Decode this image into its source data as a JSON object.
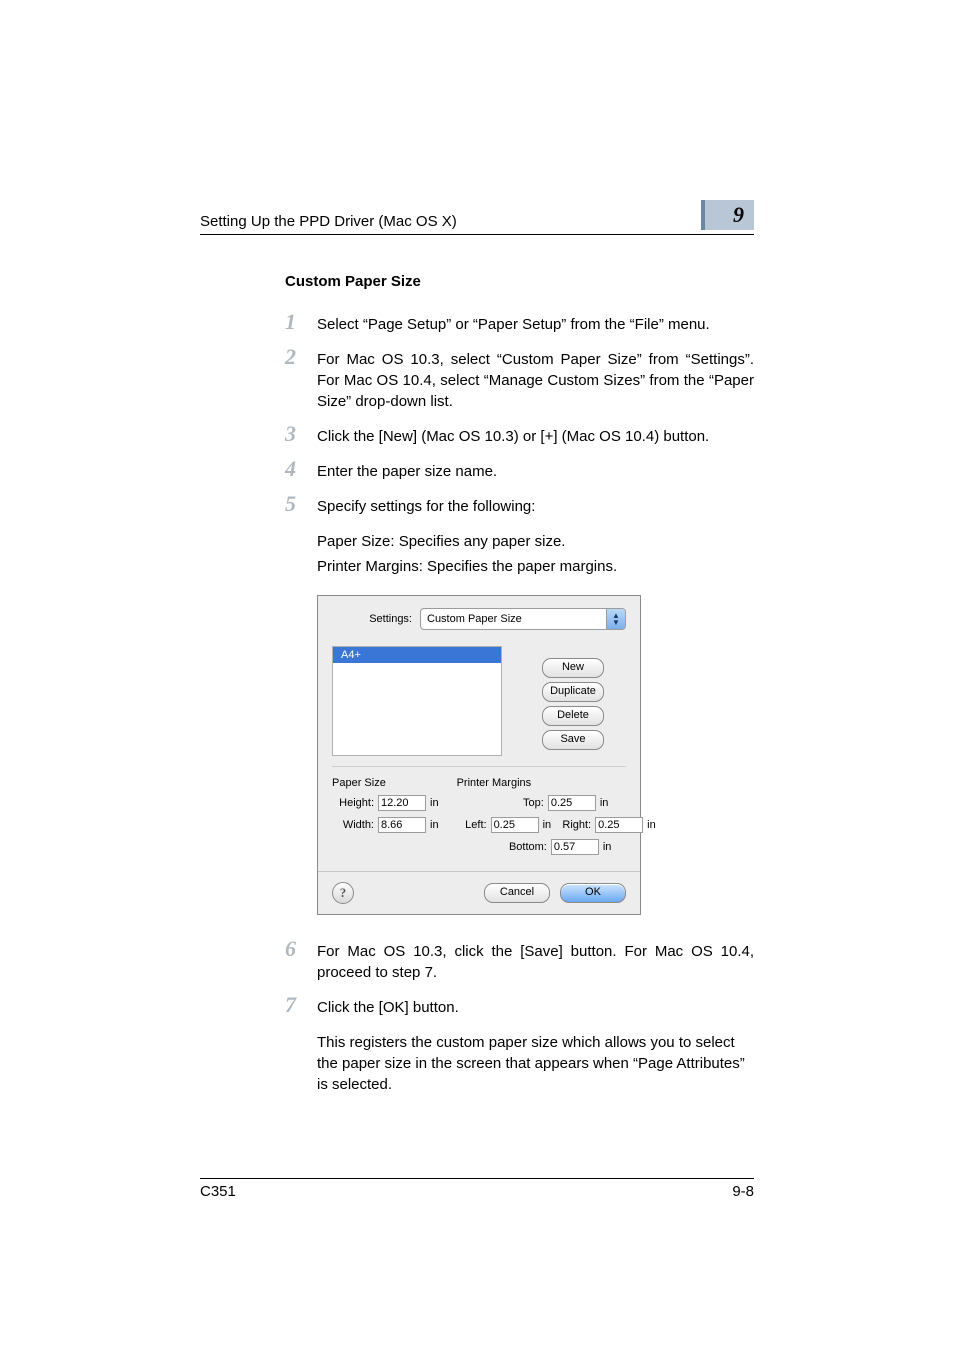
{
  "header": {
    "title": "Setting Up the PPD Driver (Mac OS X)",
    "chapter_number": "9"
  },
  "section_title": "Custom Paper Size",
  "steps": {
    "s1": {
      "num": "1",
      "text": "Select “Page Setup” or “Paper Setup” from the “File” menu."
    },
    "s2": {
      "num": "2",
      "text": "For Mac OS 10.3, select “Custom Paper Size” from “Settings”. For Mac OS 10.4, select “Manage Custom Sizes” from the “Paper Size” drop-down list."
    },
    "s3": {
      "num": "3",
      "text": "Click the [New] (Mac OS 10.3) or [+] (Mac OS 10.4) button."
    },
    "s4": {
      "num": "4",
      "text": "Enter the paper size name."
    },
    "s5": {
      "num": "5",
      "text": "Specify settings for the following:",
      "extra1": "Paper Size: Specifies any paper size.",
      "extra2": "Printer Margins: Specifies the paper margins."
    },
    "s6": {
      "num": "6",
      "text": "For Mac OS 10.3, click the [Save] button. For Mac OS 10.4, proceed to step 7."
    },
    "s7": {
      "num": "7",
      "text": "Click the [OK] button.",
      "extra1": "This registers the custom paper size which allows you to select the paper size in the screen that appears when “Page Attributes” is selected."
    }
  },
  "dialog": {
    "settings_label": "Settings:",
    "settings_value": "Custom Paper Size",
    "list_selected": "A4+",
    "buttons": {
      "new": "New",
      "duplicate": "Duplicate",
      "delete": "Delete",
      "save": "Save",
      "cancel": "Cancel",
      "ok": "OK"
    },
    "paper_size": {
      "title": "Paper Size",
      "height_label": "Height:",
      "height_value": "12.20",
      "width_label": "Width:",
      "width_value": "8.66",
      "unit": "in"
    },
    "margins": {
      "title": "Printer Margins",
      "top_label": "Top:",
      "top_value": "0.25",
      "left_label": "Left:",
      "left_value": "0.25",
      "right_label": "Right:",
      "right_value": "0.25",
      "bottom_label": "Bottom:",
      "bottom_value": "0.57",
      "unit": "in"
    },
    "help": "?"
  },
  "footer": {
    "model": "C351",
    "page": "9-8"
  }
}
